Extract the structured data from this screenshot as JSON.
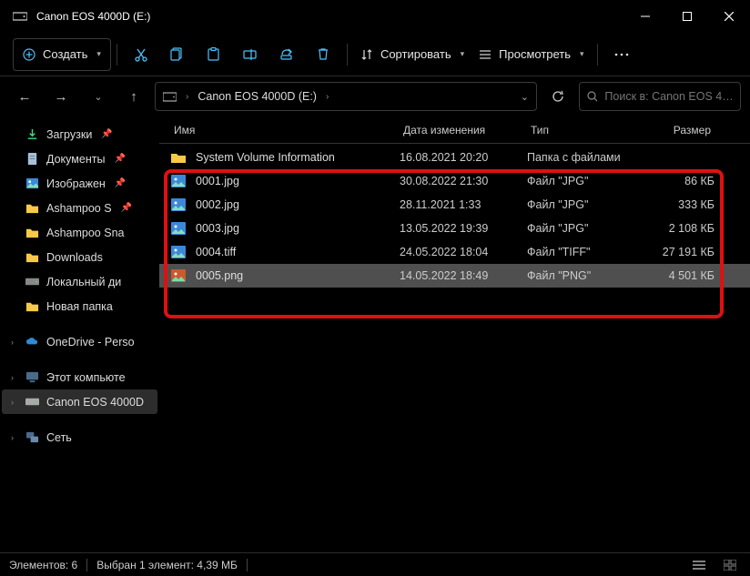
{
  "title": "Canon EOS 4000D  (E:)",
  "toolbar": {
    "create": "Создать",
    "sort": "Сортировать",
    "view": "Просмотреть"
  },
  "breadcrumb": {
    "item1": "Canon EOS 4000D  (E:)"
  },
  "search": {
    "placeholder": "Поиск в: Canon EOS 4…"
  },
  "sidebar": {
    "downloads": "Загрузки",
    "documents": "Документы",
    "pictures": "Изображен",
    "ashampoo1": "Ashampoo S",
    "ashampoo2": "Ashampoo Sna",
    "dl2": "Downloads",
    "localdisk": "Локальный ди",
    "newfolder": "Новая папка",
    "onedrive": "OneDrive - Perso",
    "thispc": "Этот компьюте",
    "canon": "Canon EOS 4000D",
    "network": "Сеть"
  },
  "columns": {
    "name": "Имя",
    "date": "Дата изменения",
    "type": "Тип",
    "size": "Размер"
  },
  "rows": [
    {
      "name": "System Volume Information",
      "date": "16.08.2021 20:20",
      "type": "Папка с файлами",
      "size": "",
      "icon": "folder",
      "sel": false
    },
    {
      "name": "0001.jpg",
      "date": "30.08.2022 21:30",
      "type": "Файл \"JPG\"",
      "size": "86 КБ",
      "icon": "image",
      "sel": false
    },
    {
      "name": "0002.jpg",
      "date": "28.11.2021 1:33",
      "type": "Файл \"JPG\"",
      "size": "333 КБ",
      "icon": "image",
      "sel": false
    },
    {
      "name": "0003.jpg",
      "date": "13.05.2022 19:39",
      "type": "Файл \"JPG\"",
      "size": "2 108 КБ",
      "icon": "image",
      "sel": false
    },
    {
      "name": "0004.tiff",
      "date": "24.05.2022 18:04",
      "type": "Файл \"TIFF\"",
      "size": "27 191 КБ",
      "icon": "image",
      "sel": false
    },
    {
      "name": "0005.png",
      "date": "14.05.2022 18:49",
      "type": "Файл \"PNG\"",
      "size": "4 501 КБ",
      "icon": "png",
      "sel": true
    }
  ],
  "status": {
    "count": "Элементов: 6",
    "sel": "Выбран 1 элемент: 4,39 МБ"
  }
}
